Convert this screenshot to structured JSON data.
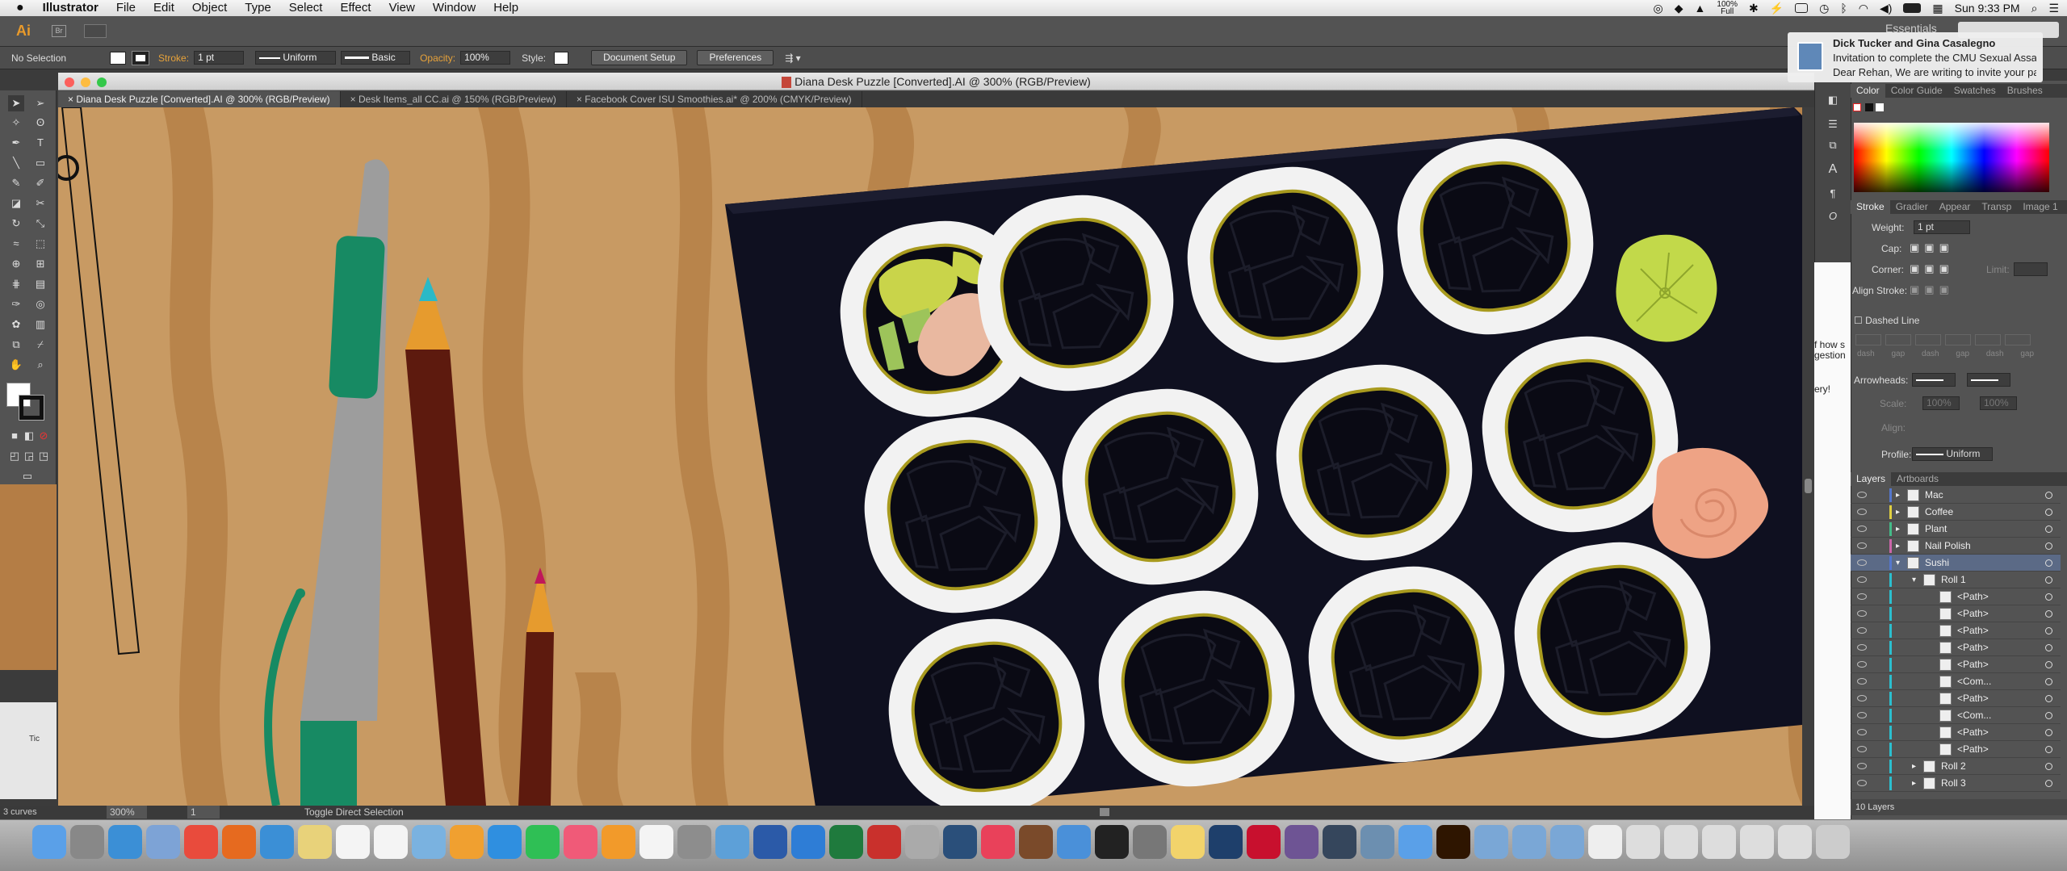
{
  "menubar": {
    "app": "Illustrator",
    "items": [
      "File",
      "Edit",
      "Object",
      "Type",
      "Select",
      "Effect",
      "View",
      "Window",
      "Help"
    ],
    "battery": "100%",
    "battery_sub": "Full",
    "clock": "Sun 9:33 PM"
  },
  "appbar": {
    "logo": "Ai",
    "bridge": "Br",
    "workspace": "Essentials"
  },
  "control": {
    "selection": "No Selection",
    "stroke_label": "Stroke:",
    "stroke_weight": "1 pt",
    "profile": "Uniform",
    "brush": "Basic",
    "opacity_label": "Opacity:",
    "opacity": "100%",
    "style_label": "Style:",
    "doc_setup": "Document Setup",
    "preferences": "Preferences"
  },
  "window": {
    "title": "Diana Desk Puzzle [Converted].AI @ 300% (RGB/Preview)"
  },
  "tabs": [
    {
      "label": "Diana Desk Puzzle [Converted].AI @ 300% (RGB/Preview)",
      "active": true
    },
    {
      "label": "Desk Items_all CC.ai @ 150% (RGB/Preview)",
      "active": false
    },
    {
      "label": "Facebook Cover ISU Smoothies.ai* @ 200% (CMYK/Preview)",
      "active": false
    }
  ],
  "status": {
    "zoom": "300%",
    "artboard": "1",
    "hint": "Toggle Direct Selection",
    "curves": "3 curves"
  },
  "notification": {
    "title": "Dick Tucker and Gina Casalegno",
    "line1": "Invitation to complete the CMU Sexual Assault...",
    "line2": "Dear Rehan, We are writing to invite your partici..."
  },
  "color_panel": {
    "tabs": [
      "Color",
      "Color Guide",
      "Swatches",
      "Brushes"
    ]
  },
  "stroke_panel": {
    "tabs": [
      "Stroke",
      "Gradier",
      "Appear",
      "Transp",
      "Image 1"
    ],
    "weight_label": "Weight:",
    "weight": "1 pt",
    "cap_label": "Cap:",
    "corner_label": "Corner:",
    "limit_label": "Limit:",
    "align_label": "Align Stroke:",
    "dashed_label": "Dashed Line",
    "dash_labels": [
      "dash",
      "gap",
      "dash",
      "gap",
      "dash",
      "gap"
    ],
    "arrowheads_label": "Arrowheads:",
    "scale_label": "Scale:",
    "scale1": "100%",
    "scale2": "100%",
    "align2_label": "Align:",
    "profile_label": "Profile:",
    "profile": "Uniform"
  },
  "layers_panel": {
    "tabs": [
      "Layers",
      "Artboards"
    ],
    "rows": [
      "Mac",
      "Coffee",
      "Plant",
      "Nail Polish",
      "Sushi",
      "Roll 1",
      "<Path>",
      "<Path>",
      "<Path>",
      "<Path>",
      "<Path>",
      "<Com...",
      "<Path>",
      "<Com...",
      "<Path>",
      "<Path>",
      "Roll 2",
      "Roll 3"
    ],
    "count": "10 Layers"
  },
  "behind_text": {
    "a": "f how s",
    "b": "gestion",
    "c": "ery!",
    "d": "Tic"
  },
  "colors": {
    "wood": "#c89a63",
    "wood_dark": "#b8844b",
    "tray": "#0f1020",
    "rice": "#f2f2f2",
    "nori_edge": "#a89a1e",
    "avocado": "#c9d44a",
    "salmon": "#e9b8a0",
    "wasabi": "#c2d94a",
    "ginger": "#eea385",
    "pen_green": "#178a63",
    "pencil": "#5d1a0e",
    "accent_orange": "#e69b2e"
  }
}
